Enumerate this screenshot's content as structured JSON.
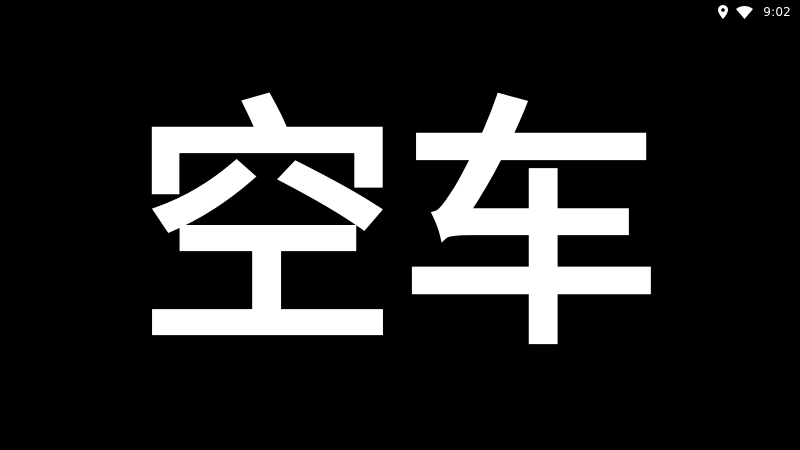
{
  "status_bar": {
    "icons": [
      "location-icon",
      "wifi-icon"
    ],
    "time": "9:02"
  },
  "main": {
    "headline": "空车"
  },
  "colors": {
    "background": "#000000",
    "foreground": "#ffffff"
  }
}
